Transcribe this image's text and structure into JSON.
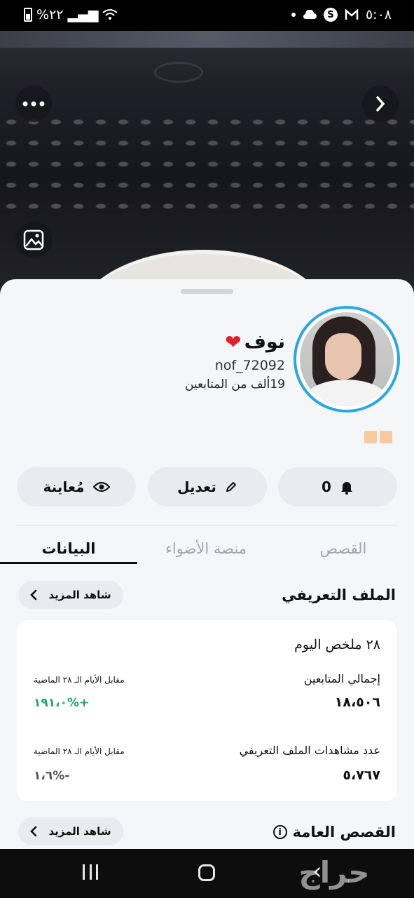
{
  "status_bar": {
    "battery_percent": "%٢٢",
    "time": "٥:٠٨"
  },
  "profile": {
    "name": "نوف",
    "username": "nof_72092",
    "followers_count": "19",
    "followers_label": "ألف من المتابعين"
  },
  "actions": {
    "preview_label": "مُعاينة",
    "edit_label": "تعديل",
    "notifications_count": "0"
  },
  "tabs": [
    {
      "label": "البيانات",
      "active": true
    },
    {
      "label": "منصة الأضواء",
      "active": false
    },
    {
      "label": "القصص",
      "active": false
    }
  ],
  "sections": {
    "profile_title": "الملف التعريفي",
    "public_stories_title": "القصص العامة",
    "see_more_label": "شاهد المزيد"
  },
  "summary_card": {
    "title": "٢٨ ملخص اليوم",
    "total_followers_label": "إجمالي المتابعين",
    "total_followers_value": "١٨،٥٠٦",
    "followers_compare_label": "مقابل الأيام الـ ٢٨ الماضية",
    "followers_change": "+%١٩١،٠",
    "profile_views_label": "عدد مشاهدات الملف التعريفي",
    "profile_views_value": "٥،٧٦٧",
    "views_compare_label": "مقابل الأيام الـ ٢٨ الماضية",
    "views_change": "-%١،٦"
  },
  "colors": {
    "avatar_ring": "#2aa8e0",
    "positive": "#1fa66b",
    "heart": "#e0202a"
  },
  "watermark": "حراج"
}
